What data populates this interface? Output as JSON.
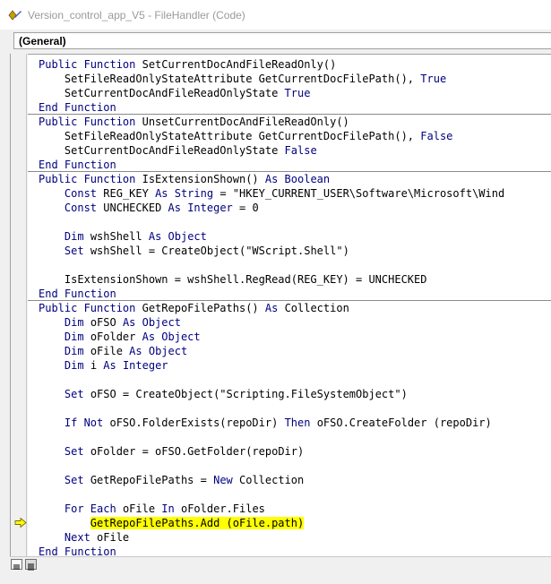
{
  "window": {
    "title": "Version_control_app_V5 - FileHandler (Code)"
  },
  "object_combo": {
    "value": "(General)"
  },
  "code_lines": [
    [
      {
        "t": "Public Function ",
        "k": 1
      },
      {
        "t": "SetCurrentDocAndFileReadOnly()"
      }
    ],
    [
      {
        "t": "    SetFileReadOnlyStateAttribute GetCurrentDocFilePath(), "
      },
      {
        "t": "True",
        "k": 1
      }
    ],
    [
      {
        "t": "    SetCurrentDocAndFileReadOnlyState "
      },
      {
        "t": "True",
        "k": 1
      }
    ],
    [
      {
        "t": "End Function",
        "k": 1
      }
    ],
    [
      {
        "t": "Public Function ",
        "k": 1
      },
      {
        "t": "UnsetCurrentDocAndFileReadOnly()"
      }
    ],
    [
      {
        "t": "    SetFileReadOnlyStateAttribute GetCurrentDocFilePath(), "
      },
      {
        "t": "False",
        "k": 1
      }
    ],
    [
      {
        "t": "    SetCurrentDocAndFileReadOnlyState "
      },
      {
        "t": "False",
        "k": 1
      }
    ],
    [
      {
        "t": "End Function",
        "k": 1
      }
    ],
    [
      {
        "t": "Public Function ",
        "k": 1
      },
      {
        "t": "IsExtensionShown() "
      },
      {
        "t": "As Boolean",
        "k": 1
      }
    ],
    [
      {
        "t": "    "
      },
      {
        "t": "Const ",
        "k": 1
      },
      {
        "t": "REG_KEY "
      },
      {
        "t": "As String",
        "k": 1
      },
      {
        "t": " = \"HKEY_CURRENT_USER\\Software\\Microsoft\\Wind"
      }
    ],
    [
      {
        "t": "    "
      },
      {
        "t": "Const ",
        "k": 1
      },
      {
        "t": "UNCHECKED "
      },
      {
        "t": "As Integer",
        "k": 1
      },
      {
        "t": " = 0"
      }
    ],
    [],
    [
      {
        "t": "    "
      },
      {
        "t": "Dim ",
        "k": 1
      },
      {
        "t": "wshShell "
      },
      {
        "t": "As Object",
        "k": 1
      }
    ],
    [
      {
        "t": "    "
      },
      {
        "t": "Set ",
        "k": 1
      },
      {
        "t": "wshShell = CreateObject(\"WScript.Shell\")"
      }
    ],
    [],
    [
      {
        "t": "    IsExtensionShown = wshShell.RegRead(REG_KEY) = UNCHECKED"
      }
    ],
    [
      {
        "t": "End Function",
        "k": 1
      }
    ],
    [
      {
        "t": "Public Function ",
        "k": 1
      },
      {
        "t": "GetRepoFilePaths() "
      },
      {
        "t": "As ",
        "k": 1
      },
      {
        "t": "Collection"
      }
    ],
    [
      {
        "t": "    "
      },
      {
        "t": "Dim ",
        "k": 1
      },
      {
        "t": "oFSO "
      },
      {
        "t": "As Object",
        "k": 1
      }
    ],
    [
      {
        "t": "    "
      },
      {
        "t": "Dim ",
        "k": 1
      },
      {
        "t": "oFolder "
      },
      {
        "t": "As Object",
        "k": 1
      }
    ],
    [
      {
        "t": "    "
      },
      {
        "t": "Dim ",
        "k": 1
      },
      {
        "t": "oFile "
      },
      {
        "t": "As Object",
        "k": 1
      }
    ],
    [
      {
        "t": "    "
      },
      {
        "t": "Dim ",
        "k": 1
      },
      {
        "t": "i "
      },
      {
        "t": "As Integer",
        "k": 1
      }
    ],
    [],
    [
      {
        "t": "    "
      },
      {
        "t": "Set ",
        "k": 1
      },
      {
        "t": "oFSO = CreateObject(\"Scripting.FileSystemObject\")"
      }
    ],
    [],
    [
      {
        "t": "    "
      },
      {
        "t": "If Not ",
        "k": 1
      },
      {
        "t": "oFSO.FolderExists(repoDir) "
      },
      {
        "t": "Then ",
        "k": 1
      },
      {
        "t": "oFSO.CreateFolder (repoDir)"
      }
    ],
    [],
    [
      {
        "t": "    "
      },
      {
        "t": "Set ",
        "k": 1
      },
      {
        "t": "oFolder = oFSO.GetFolder(repoDir)"
      }
    ],
    [],
    [
      {
        "t": "    "
      },
      {
        "t": "Set ",
        "k": 1
      },
      {
        "t": "GetRepoFilePaths = "
      },
      {
        "t": "New ",
        "k": 1
      },
      {
        "t": "Collection"
      }
    ],
    [],
    [
      {
        "t": "    "
      },
      {
        "t": "For Each ",
        "k": 1
      },
      {
        "t": "oFile "
      },
      {
        "t": "In ",
        "k": 1
      },
      {
        "t": "oFolder.Files"
      }
    ],
    [
      {
        "t": "        "
      },
      {
        "t": "GetRepoFilePaths.Add (oFile.path)",
        "h": 1
      }
    ],
    [
      {
        "t": "    "
      },
      {
        "t": "Next ",
        "k": 1
      },
      {
        "t": "oFile"
      }
    ],
    [
      {
        "t": "End Function",
        "k": 1
      }
    ]
  ],
  "procedure_separators_after_line": [
    3,
    7,
    16
  ],
  "current_line": 32,
  "colors": {
    "keyword": "#00007f",
    "highlight": "#ffff00"
  }
}
